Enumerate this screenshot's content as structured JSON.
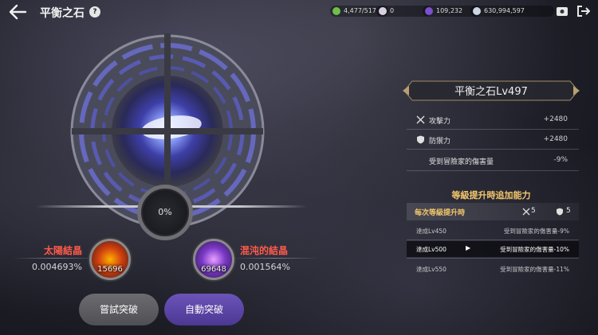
{
  "header": {
    "title": "平衡之石",
    "resources": [
      {
        "icon": "leaf-energy-icon",
        "value": "4,477/517",
        "color": "#6fbf4a"
      },
      {
        "icon": "pearl-icon",
        "value": "0",
        "color": "#d8d0e0"
      },
      {
        "icon": "purple-gem-icon",
        "value": "109,232",
        "color": "#7a4fd0"
      },
      {
        "icon": "silver-coin-icon",
        "value": "630,994,597",
        "color": "#c9d6e6"
      }
    ]
  },
  "orb": {
    "progress_text": "0%",
    "progress": 0
  },
  "crystals": {
    "sun": {
      "label": "太陽結晶",
      "percent": "0.004693%",
      "count": "15696"
    },
    "chaos": {
      "label": "混沌的結晶",
      "percent": "0.001564%",
      "count": "69648"
    }
  },
  "buttons": {
    "try": "嘗試突破",
    "auto": "自動突破"
  },
  "panel": {
    "title": "平衡之石Lv497",
    "stats": [
      {
        "icon": "sword-icon",
        "label": "攻擊力",
        "value": "+2480"
      },
      {
        "icon": "shield-icon",
        "label": "防禦力",
        "value": "+2480"
      },
      {
        "icon": "",
        "label": "受到冒險家的傷害量",
        "value": "-9%"
      }
    ],
    "bonus_title": "等級提升時追加能力",
    "per_level": {
      "label": "每次等級提升時",
      "attack": "5",
      "defense": "5"
    },
    "levels": [
      {
        "level": "達成Lv450",
        "effect": "受到冒險家的傷害量-9%",
        "active": false
      },
      {
        "level": "達成Lv500",
        "effect": "受到冒險家的傷害量-10%",
        "active": true
      },
      {
        "level": "達成Lv550",
        "effect": "受到冒險家的傷害量-11%",
        "active": false
      }
    ]
  },
  "colors": {
    "accent_gold": "#f3c86a",
    "label_red": "#ff5a4a",
    "auto_button": "#5a44a8"
  }
}
